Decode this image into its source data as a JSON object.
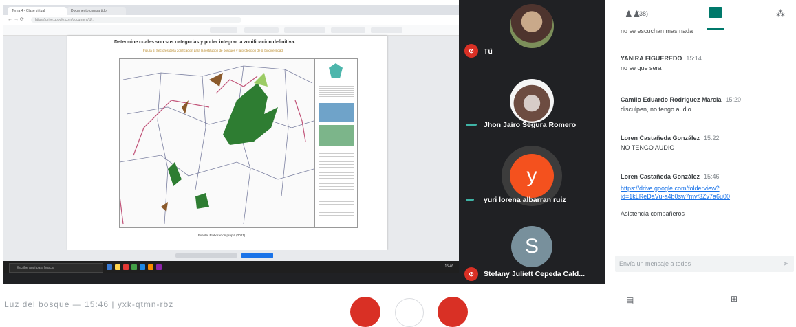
{
  "browser": {
    "tab1": "Tema 4 - Clase virtual",
    "tab2": "Documento compartido",
    "url": "https://drive.google.com/document/d/...",
    "doc_heading": "Determine cuales son sus categorias y poder integrar la zonificacion definitiva.",
    "doc_caption": "Figura 5: Sectores de la zonificacion para la restitucion de bosques y la proteccion de la biodiversidad",
    "doc_source": "Fuente: Elaboracion propia (2021)",
    "taskbar_search": "Escribe aqui para buscar",
    "taskbar_time": "15:46"
  },
  "participants": [
    {
      "name": "Tú",
      "muted": true
    },
    {
      "name": "Jhon Jairo Segura Romero",
      "muted": false
    },
    {
      "name": "yuri lorena albarran ruiz",
      "letter": "y",
      "muted": false
    },
    {
      "name": "Stefany Juliett Cepeda Cald...",
      "letter": "S",
      "muted": true
    }
  ],
  "chat": {
    "people_count": "(38)",
    "cut_message": "no se escuchan mas nada",
    "messages": [
      {
        "sender": "YANIRA FIGUEREDO",
        "time": "15:14",
        "text": "no se que sera"
      },
      {
        "sender": "Camilo Eduardo Rodriguez Marcia",
        "time": "15:20",
        "text": "disculpen, no tengo audio"
      },
      {
        "sender": "Loren Castañeda González",
        "time": "15:22",
        "text": "NO TENGO AUDIO"
      },
      {
        "sender": "Loren Castañeda González",
        "time": "15:46",
        "link1": "https://drive.google.com/folderview?",
        "link2": "id=1kLReDaVu-a4b0sw7mvf3Zv7a6u00",
        "text": "Asistencia compañeros"
      }
    ],
    "input_placeholder": "Envía un mensaje a todos"
  },
  "bottom": {
    "meeting_title": "Luz del bosque — 15:46 | yxk-qtmn-rbz"
  },
  "colors": {
    "meet_dark": "#202124",
    "mute_red": "#d93025",
    "chat_teal": "#00796b",
    "avatar_orange": "#f4511e",
    "avatar_slate": "#78909c"
  }
}
